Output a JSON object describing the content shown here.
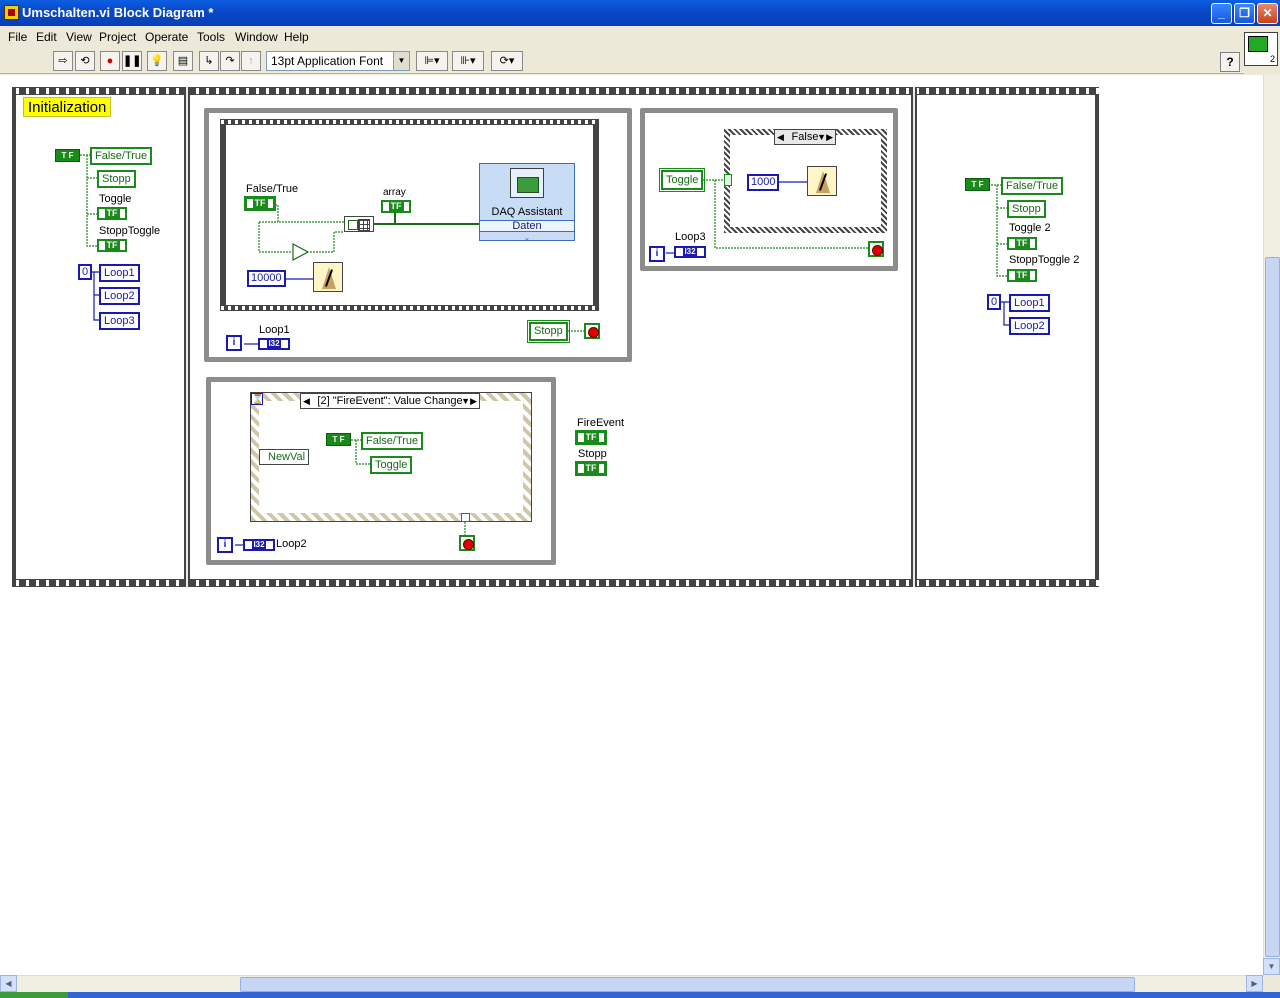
{
  "window": {
    "title": "Umschalten.vi Block Diagram *",
    "minimize": "_",
    "maximize": "❐",
    "close": "✕"
  },
  "menu": [
    "File",
    "Edit",
    "View",
    "Project",
    "Operate",
    "Tools",
    "Window",
    "Help"
  ],
  "toolbar": {
    "font": "13pt Application Font",
    "help": "?",
    "vi_icon_number": "2"
  },
  "diagram": {
    "frame1": {
      "label": "Initialization",
      "tf_const": "T F",
      "false_true": "False/True",
      "stopp": "Stopp",
      "toggle_caption": "Toggle",
      "toggle_tf": "TF",
      "stopptoggle_caption": "StoppToggle",
      "stopptoggle_tf": "TF",
      "num_const": "0",
      "loop1": "Loop1",
      "loop2": "Loop2",
      "loop3": "Loop3"
    },
    "frame2": {
      "loop_top": {
        "false_true_caption": "False/True",
        "false_true_tf": "TF",
        "array_caption": "array",
        "array_tf": "TF",
        "daq_name": "DAQ Assistant",
        "daq_port": "Daten",
        "daq_more": "⌄",
        "wait_ms": "10000",
        "loop_caption": "Loop1",
        "i32": "I32",
        "iter": "i",
        "stopp": "Stopp"
      },
      "loop_right": {
        "case_selector": "False",
        "toggle": "Toggle",
        "wait_ms": "1000",
        "loop_caption": "Loop3",
        "i32": "I32",
        "iter": "i"
      },
      "loop_bottom": {
        "event_selector": "[2] \"FireEvent\": Value Change",
        "newval": "NewVal",
        "tf_const": "T F",
        "false_true": "False/True",
        "toggle": "Toggle",
        "loop_caption": "Loop2",
        "i32": "I32",
        "iter": "i"
      },
      "fireevent_caption": "FireEvent",
      "fireevent_tf": "TF",
      "stopp_caption": "Stopp",
      "stopp_tf": "TF"
    },
    "frame3": {
      "tf_const": "T F",
      "false_true": "False/True",
      "stopp": "Stopp",
      "toggle2_caption": "Toggle 2",
      "toggle2_tf": "TF",
      "stopptoggle2_caption": "StoppToggle 2",
      "stopptoggle2_tf": "TF",
      "num_const": "0",
      "loop1": "Loop1",
      "loop2": "Loop2"
    }
  },
  "colors": {
    "boolean": "#1a8a1a",
    "numeric": "#1a1ab0",
    "structure": "#8c8c8c"
  }
}
